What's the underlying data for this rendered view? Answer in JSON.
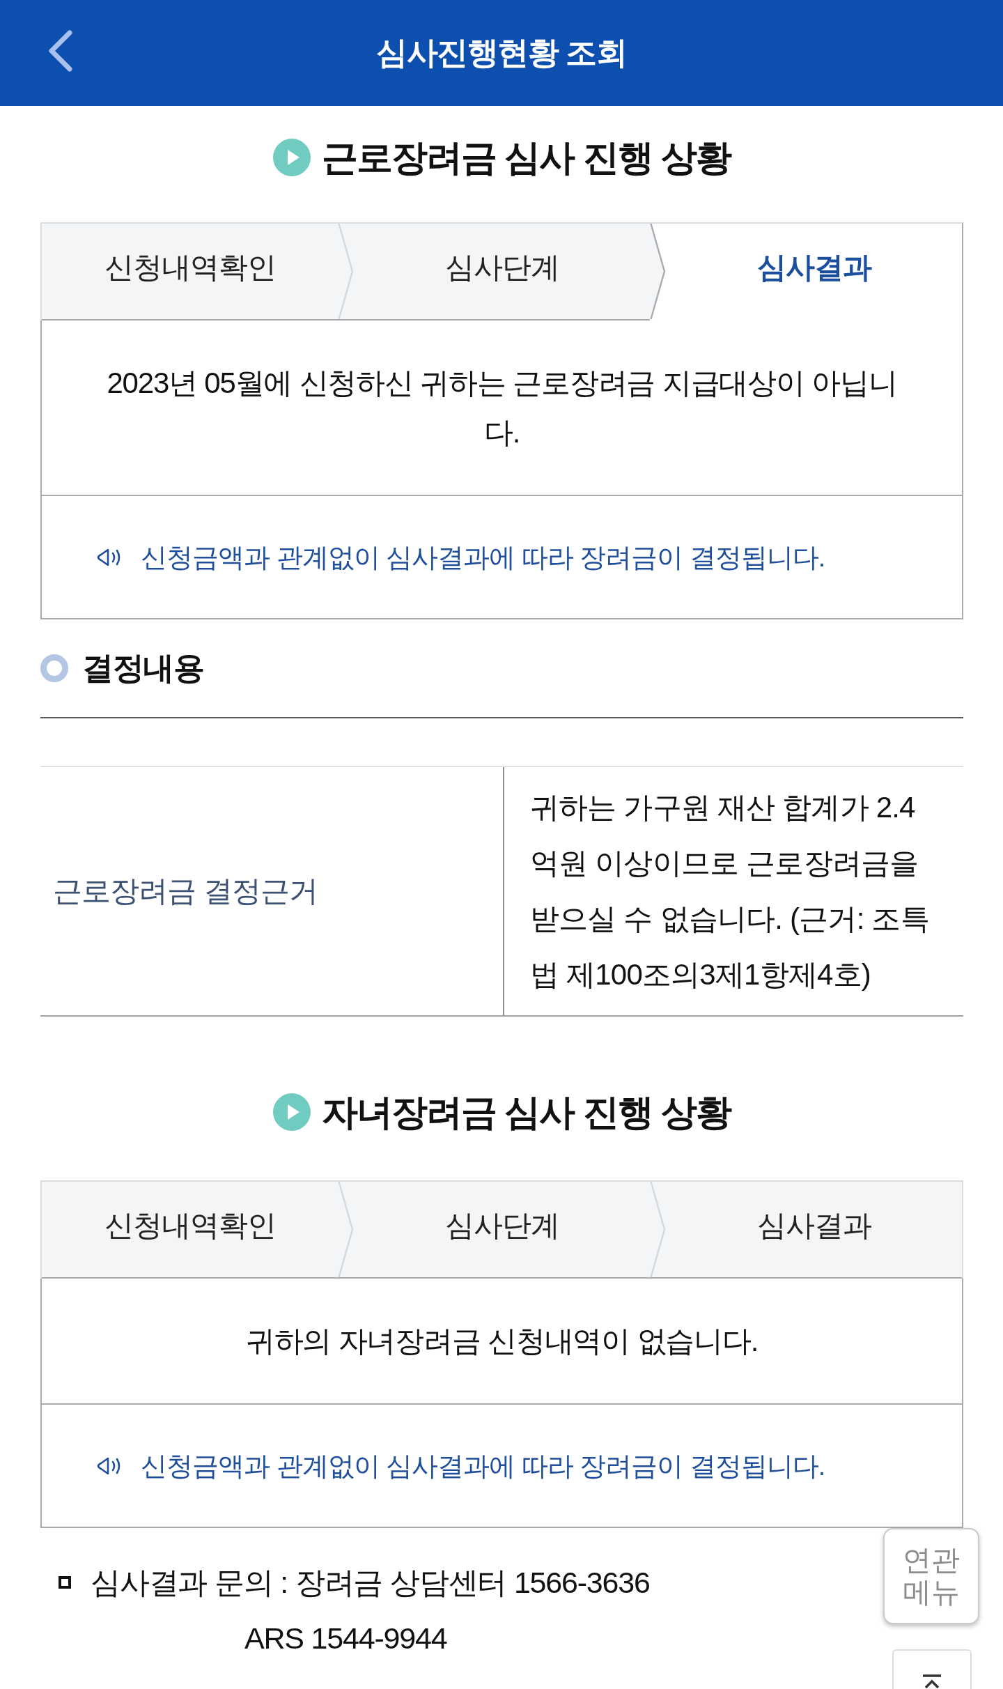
{
  "header": {
    "title": "심사진행현황 조회"
  },
  "sections": [
    {
      "title": "근로장려금 심사 진행 상황",
      "steps": [
        {
          "label": "신청내역확인",
          "selected": false
        },
        {
          "label": "심사단계",
          "selected": false
        },
        {
          "label": "심사결과",
          "selected": true
        }
      ],
      "message": "2023년 05월에 신청하신 귀하는 근로장려금 지급대상이 아닙니다.",
      "notice": "신청금액과 관계없이 심사결과에 따라 장려금이 결정됩니다.",
      "decision": {
        "heading": "결정내용",
        "rows": [
          {
            "label": "근로장려금 결정근거",
            "value": "귀하는 가구원 재산 합계가 2.4억원 이상이므로 근로장려금을 받으실 수 없습니다. (근거: 조특법 제100조의3제1항제4호)"
          }
        ]
      }
    },
    {
      "title": "자녀장려금 심사 진행 상황",
      "steps": [
        {
          "label": "신청내역확인",
          "selected": false
        },
        {
          "label": "심사단계",
          "selected": false
        },
        {
          "label": "심사결과",
          "selected": false
        }
      ],
      "message": "귀하의 자녀장려금 신청내역이 없습니다.",
      "notice": "신청금액과 관계없이 심사결과에 따라 장려금이 결정됩니다."
    }
  ],
  "inquiry": {
    "text": "심사결과 문의 : 장려금 상담센터 1566-3636",
    "ars": "ARS 1544-9944"
  },
  "related_menu": {
    "label": "연관 메뉴"
  }
}
